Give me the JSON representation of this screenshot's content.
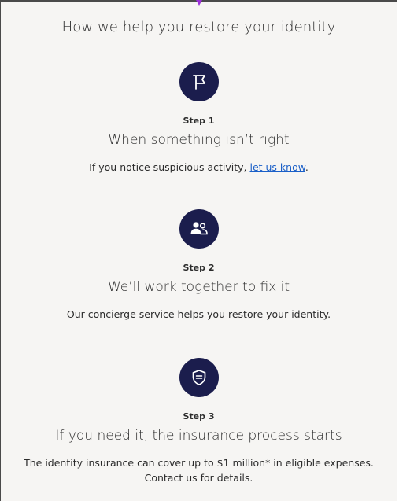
{
  "page": {
    "title": "How we help you restore your identity"
  },
  "steps": [
    {
      "icon": "flag-icon",
      "label": "Step 1",
      "heading": "When something isn’t right",
      "desc_prefix": "If you notice suspicious activity, ",
      "desc_link": "let us know",
      "desc_suffix": "."
    },
    {
      "icon": "people-icon",
      "label": "Step 2",
      "heading": "We’ll work together to fix it",
      "desc": "Our concierge service helps you restore your identity."
    },
    {
      "icon": "shield-icon",
      "label": "Step 3",
      "heading": "If you need it, the insurance process starts",
      "desc_line1": "The identity insurance can cover up to $1 million* in eligible expenses.",
      "desc_line2": "Contact us for details."
    }
  ],
  "colors": {
    "icon_bg": "#1b1d4d",
    "link": "#1a5fc8",
    "background": "#f6f5f3"
  }
}
